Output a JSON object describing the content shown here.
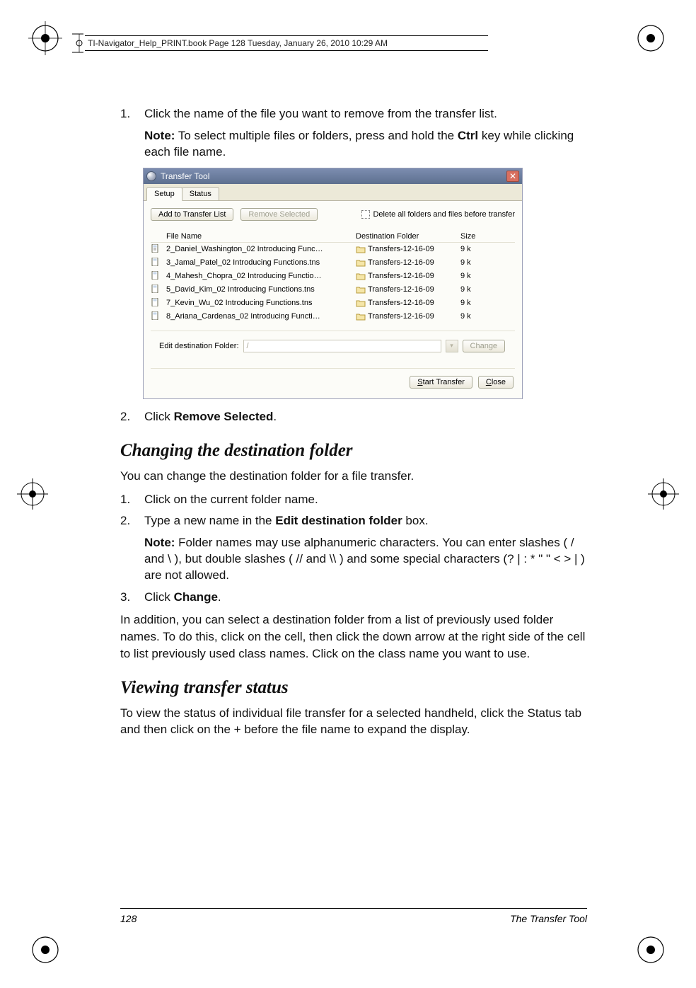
{
  "header": {
    "text": "TI-Navigator_Help_PRINT.book  Page 128  Tuesday, January 26, 2010  10:29 AM"
  },
  "step1": {
    "num": "1.",
    "text": "Click the name of the file you want to remove from the transfer list.",
    "note_label": "Note:",
    "note_a": " To select multiple files or folders, press and hold the ",
    "ctrl": "Ctrl",
    "note_b": " key while clicking each file name."
  },
  "tt": {
    "title": "Transfer Tool",
    "tab_setup": "Setup",
    "tab_status": "Status",
    "btn_add": "Add to Transfer List",
    "btn_remove": "Remove Selected",
    "chk_delete": "Delete all folders and files before transfer",
    "col_file": "File Name",
    "col_dest": "Destination Folder",
    "col_size": "Size",
    "rows": [
      {
        "file": "2_Daniel_Washington_02 Introducing Func…",
        "dest": "Transfers-12-16-09",
        "size": "9 k"
      },
      {
        "file": "3_Jamal_Patel_02 Introducing Functions.tns",
        "dest": "Transfers-12-16-09",
        "size": "9 k"
      },
      {
        "file": "4_Mahesh_Chopra_02 Introducing Functio…",
        "dest": "Transfers-12-16-09",
        "size": "9 k"
      },
      {
        "file": "5_David_Kim_02 Introducing Functions.tns",
        "dest": "Transfers-12-16-09",
        "size": "9 k"
      },
      {
        "file": "7_Kevin_Wu_02 Introducing Functions.tns",
        "dest": "Transfers-12-16-09",
        "size": "9 k"
      },
      {
        "file": "8_Ariana_Cardenas_02 Introducing Functi…",
        "dest": "Transfers-12-16-09",
        "size": "9 k"
      }
    ],
    "edit_label": "Edit destination Folder:",
    "edit_value": "/",
    "btn_change": "Change",
    "btn_start": "Start Transfer",
    "btn_close": "Close",
    "start_u": "S",
    "close_u": "C"
  },
  "step2": {
    "num": "2.",
    "text_a": "Click ",
    "bold": "Remove Selected",
    "text_b": "."
  },
  "h2a": "Changing the destination folder",
  "p_a": "You can change the destination folder for a file transfer.",
  "step_a1": {
    "num": "1.",
    "text": "Click on the current folder name."
  },
  "step_a2": {
    "num": "2.",
    "text_a": "Type a new name in the ",
    "bold": "Edit destination folder",
    "text_b": " box.",
    "note_label": "Note:",
    "note": " Folder names may use alphanumeric characters. You can enter slashes ( / and \\ ), but double slashes ( // and \\\\ ) and some special characters (? | : * \" \" < > | ) are not allowed."
  },
  "step_a3": {
    "num": "3.",
    "text_a": "Click ",
    "bold": "Change",
    "text_b": "."
  },
  "p_b": "In addition, you can select a destination folder from a list of previously used folder names. To do this, click on the cell, then click the down arrow at the right side of the cell to list previously used class names. Click on the class name you want to use.",
  "h2b": "Viewing transfer status",
  "p_c": "To view the status of individual file transfer for a selected handheld, click the Status tab and then click on the + before the file name to expand the display.",
  "footer": {
    "page": "128",
    "text": "The Transfer Tool"
  }
}
